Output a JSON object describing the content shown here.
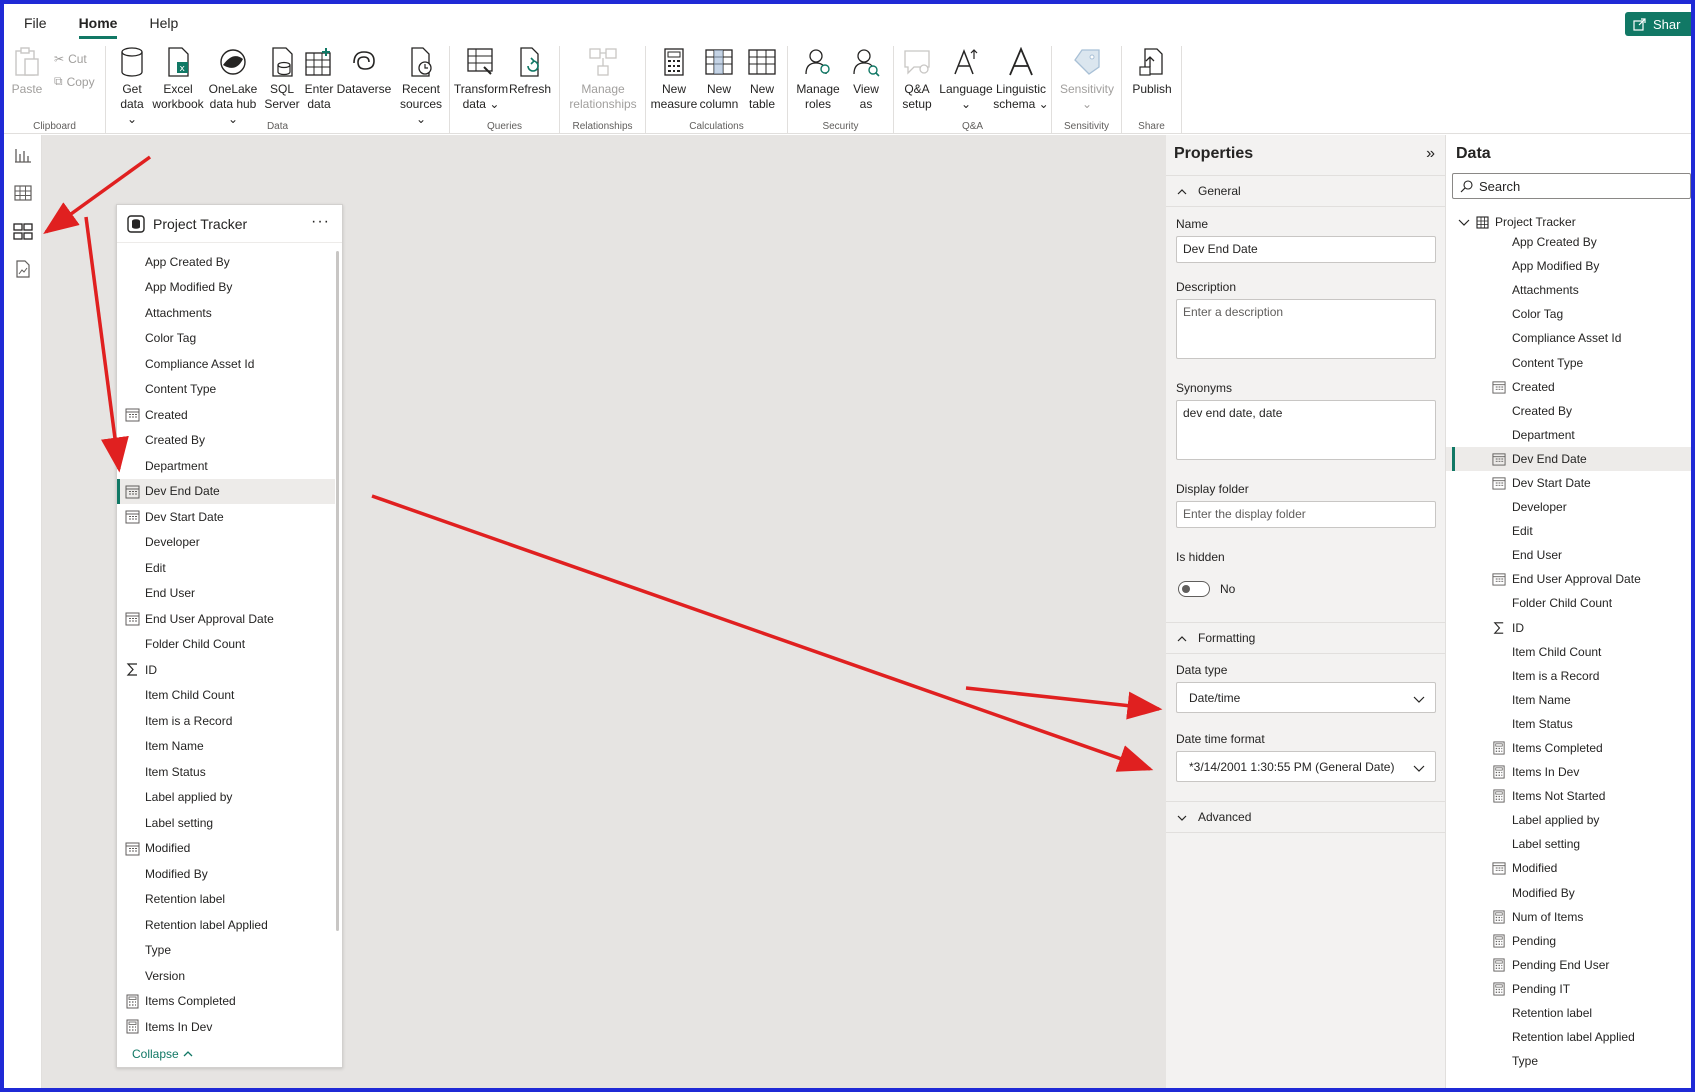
{
  "menu": {
    "file": "File",
    "home": "Home",
    "help": "Help",
    "share": "Shar"
  },
  "ribbon": {
    "clipboard": {
      "label": "Clipboard",
      "paste": "Paste",
      "cut": "Cut",
      "copy": "Copy"
    },
    "data": {
      "label": "Data",
      "get_data": "Get\ndata ⌄",
      "excel": "Excel\nworkbook",
      "onelake": "OneLake\ndata hub ⌄",
      "sql": "SQL\nServer",
      "enter": "Enter\ndata",
      "dataverse": "Dataverse",
      "recent": "Recent\nsources ⌄"
    },
    "queries": {
      "label": "Queries",
      "transform": "Transform\ndata ⌄",
      "refresh": "Refresh"
    },
    "relationships": {
      "label": "Relationships",
      "manage": "Manage\nrelationships"
    },
    "calculations": {
      "label": "Calculations",
      "measure": "New\nmeasure",
      "column": "New\ncolumn",
      "table": "New\ntable"
    },
    "security": {
      "label": "Security",
      "manage_roles": "Manage\nroles",
      "view_as": "View\nas"
    },
    "qa": {
      "label": "Q&A",
      "setup": "Q&A\nsetup",
      "language": "Language\n⌄",
      "schema": "Linguistic\nschema ⌄"
    },
    "sensitivity": {
      "label": "Sensitivity",
      "sensitivity": "Sensitivity\n⌄"
    },
    "share": {
      "label": "Share",
      "publish": "Publish"
    }
  },
  "card": {
    "title": "Project Tracker",
    "more": "···",
    "collapse": "Collapse",
    "fields": [
      {
        "name": "App Created By",
        "icon": ""
      },
      {
        "name": "App Modified By",
        "icon": ""
      },
      {
        "name": "Attachments",
        "icon": ""
      },
      {
        "name": "Color Tag",
        "icon": ""
      },
      {
        "name": "Compliance Asset Id",
        "icon": ""
      },
      {
        "name": "Content Type",
        "icon": ""
      },
      {
        "name": "Created",
        "icon": "calendar"
      },
      {
        "name": "Created By",
        "icon": ""
      },
      {
        "name": "Department",
        "icon": ""
      },
      {
        "name": "Dev End Date",
        "icon": "calendar",
        "selected": true
      },
      {
        "name": "Dev Start Date",
        "icon": "calendar"
      },
      {
        "name": "Developer",
        "icon": ""
      },
      {
        "name": "Edit",
        "icon": ""
      },
      {
        "name": "End User",
        "icon": ""
      },
      {
        "name": "End User Approval Date",
        "icon": "calendar"
      },
      {
        "name": "Folder Child Count",
        "icon": ""
      },
      {
        "name": "ID",
        "icon": "sigma"
      },
      {
        "name": "Item Child Count",
        "icon": ""
      },
      {
        "name": "Item is a Record",
        "icon": ""
      },
      {
        "name": "Item Name",
        "icon": ""
      },
      {
        "name": "Item Status",
        "icon": ""
      },
      {
        "name": "Label applied by",
        "icon": ""
      },
      {
        "name": "Label setting",
        "icon": ""
      },
      {
        "name": "Modified",
        "icon": "calendar"
      },
      {
        "name": "Modified By",
        "icon": ""
      },
      {
        "name": "Retention label",
        "icon": ""
      },
      {
        "name": "Retention label Applied",
        "icon": ""
      },
      {
        "name": "Type",
        "icon": ""
      },
      {
        "name": "Version",
        "icon": ""
      },
      {
        "name": "Items Completed",
        "icon": "calculator"
      },
      {
        "name": "Items In Dev",
        "icon": "calculator"
      }
    ]
  },
  "properties": {
    "title": "Properties",
    "general": "General",
    "name_label": "Name",
    "name_value": "Dev End Date",
    "description_label": "Description",
    "description_placeholder": "Enter a description",
    "synonyms_label": "Synonyms",
    "synonyms_value": "dev end date, date",
    "display_folder_label": "Display folder",
    "display_folder_placeholder": "Enter the display folder",
    "is_hidden_label": "Is hidden",
    "is_hidden_value": "No",
    "formatting": "Formatting",
    "data_type_label": "Data type",
    "data_type_value": "Date/time",
    "date_format_label": "Date time format",
    "date_format_value": "*3/14/2001 1:30:55 PM (General Date)",
    "advanced": "Advanced"
  },
  "data_pane": {
    "title": "Data",
    "search_placeholder": "Search",
    "root": "Project Tracker",
    "items": [
      {
        "name": "App Created By",
        "icon": ""
      },
      {
        "name": "App Modified By",
        "icon": ""
      },
      {
        "name": "Attachments",
        "icon": ""
      },
      {
        "name": "Color Tag",
        "icon": ""
      },
      {
        "name": "Compliance Asset Id",
        "icon": ""
      },
      {
        "name": "Content Type",
        "icon": ""
      },
      {
        "name": "Created",
        "icon": "calendar"
      },
      {
        "name": "Created By",
        "icon": ""
      },
      {
        "name": "Department",
        "icon": ""
      },
      {
        "name": "Dev End Date",
        "icon": "calendar",
        "selected": true
      },
      {
        "name": "Dev Start Date",
        "icon": "calendar"
      },
      {
        "name": "Developer",
        "icon": ""
      },
      {
        "name": "Edit",
        "icon": ""
      },
      {
        "name": "End User",
        "icon": ""
      },
      {
        "name": "End User Approval Date",
        "icon": "calendar"
      },
      {
        "name": "Folder Child Count",
        "icon": ""
      },
      {
        "name": "ID",
        "icon": "sigma"
      },
      {
        "name": "Item Child Count",
        "icon": ""
      },
      {
        "name": "Item is a Record",
        "icon": ""
      },
      {
        "name": "Item Name",
        "icon": ""
      },
      {
        "name": "Item Status",
        "icon": ""
      },
      {
        "name": "Items Completed",
        "icon": "calculator"
      },
      {
        "name": "Items In Dev",
        "icon": "calculator"
      },
      {
        "name": "Items Not Started",
        "icon": "calculator"
      },
      {
        "name": "Label applied by",
        "icon": ""
      },
      {
        "name": "Label setting",
        "icon": ""
      },
      {
        "name": "Modified",
        "icon": "calendar"
      },
      {
        "name": "Modified By",
        "icon": ""
      },
      {
        "name": "Num of Items",
        "icon": "calculator"
      },
      {
        "name": "Pending",
        "icon": "calculator"
      },
      {
        "name": "Pending End User",
        "icon": "calculator"
      },
      {
        "name": "Pending IT",
        "icon": "calculator"
      },
      {
        "name": "Retention label",
        "icon": ""
      },
      {
        "name": "Retention label Applied",
        "icon": ""
      },
      {
        "name": "Type",
        "icon": ""
      }
    ]
  },
  "colors": {
    "accent": "#117865",
    "arrow": "#e02020",
    "frame": "#1f2ad6",
    "canvas": "#e6e4e2"
  }
}
